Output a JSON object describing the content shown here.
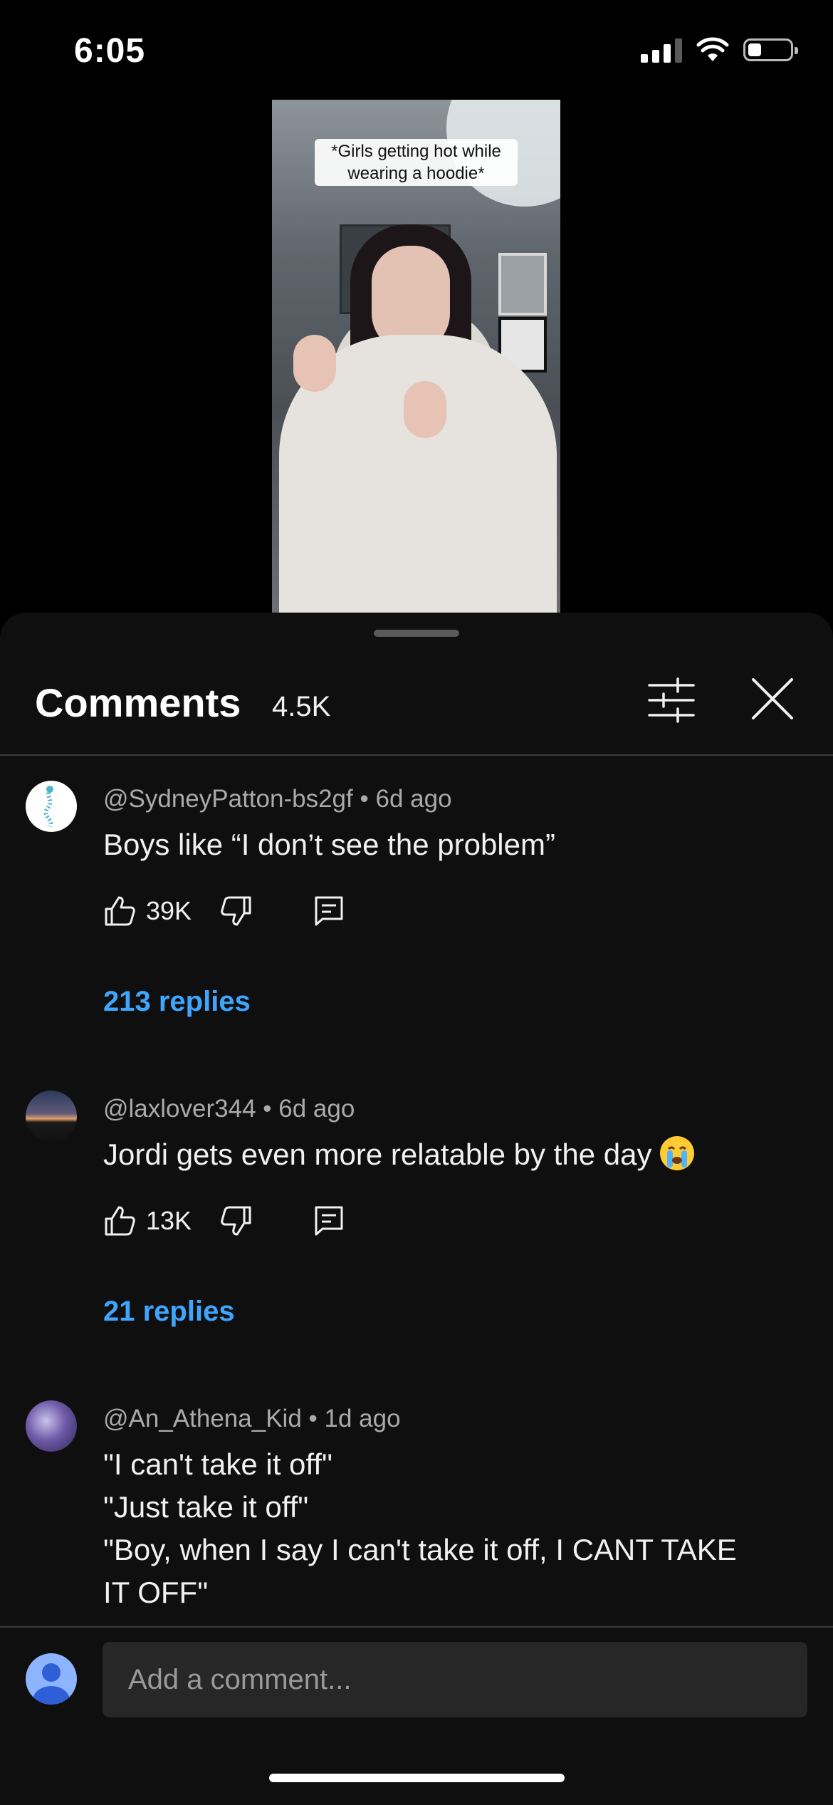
{
  "status_bar": {
    "time": "6:05"
  },
  "video": {
    "caption": "*Girls getting hot while wearing a hoodie*"
  },
  "comments_panel": {
    "title": "Comments",
    "count": "4.5K",
    "comments": [
      {
        "author": "@SydneyPatton-bs2gf",
        "time": "6d ago",
        "text": "Boys like “I don’t see the problem”",
        "likes": "39K",
        "replies": "213 replies"
      },
      {
        "author": "@laxlover344",
        "time": "6d ago",
        "text": "Jordi gets even more relatable by the day",
        "likes": "13K",
        "replies": "21 replies"
      },
      {
        "author": "@An_Athena_Kid",
        "time": "1d ago",
        "lines": [
          "\"I can't take it off\"",
          "\"Just take it off\"",
          "\"Boy, when I say I can't take it off, I CANT TAKE IT OFF\""
        ]
      }
    ],
    "separator": "•"
  },
  "composer": {
    "placeholder": "Add a comment..."
  }
}
